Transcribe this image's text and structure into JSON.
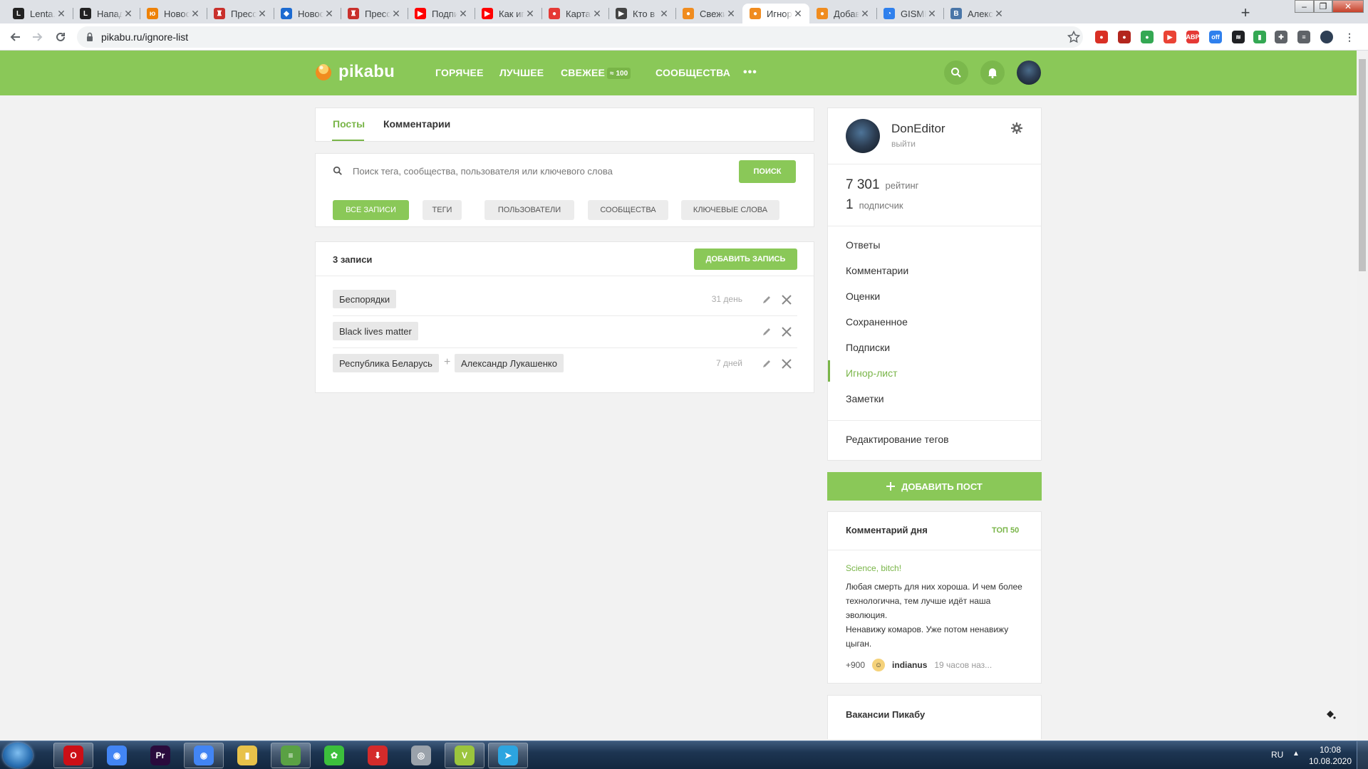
{
  "browser": {
    "tabs": [
      {
        "title": "Lenta.ru",
        "icon": "lenta-icon",
        "color": "#222222",
        "glyph": "L"
      },
      {
        "title": "Нападен",
        "icon": "lenta-icon",
        "color": "#222222",
        "glyph": "L"
      },
      {
        "title": "Новости",
        "icon": "ok-icon",
        "color": "#ee8208",
        "glyph": "ю"
      },
      {
        "title": "Пресс-це",
        "icon": "emblem-icon",
        "color": "#c9302c",
        "glyph": "♜"
      },
      {
        "title": "Новости",
        "icon": "flag-icon",
        "color": "#1c6bd1",
        "glyph": "◆"
      },
      {
        "title": "Пресс-це",
        "icon": "emblem-icon",
        "color": "#c9302c",
        "glyph": "♜"
      },
      {
        "title": "Подписк",
        "icon": "youtube-icon",
        "color": "#ff0000",
        "glyph": "▶"
      },
      {
        "title": "Как игра",
        "icon": "youtube-icon",
        "color": "#ff0000",
        "glyph": "▶"
      },
      {
        "title": "Карта ра",
        "icon": "maps-pin-icon",
        "color": "#e53935",
        "glyph": "●"
      },
      {
        "title": "Кто в",
        "icon": "play-icon",
        "color": "#444444",
        "glyph": "▶"
      },
      {
        "title": "Свежие",
        "icon": "pikabu-icon",
        "color": "#f08c1f",
        "glyph": "●"
      },
      {
        "title": "Игнор-л",
        "icon": "pikabu-icon",
        "color": "#f08c1f",
        "glyph": "●"
      },
      {
        "title": "Добавит",
        "icon": "pikabu-icon",
        "color": "#f08c1f",
        "glyph": "●"
      },
      {
        "title": "GISMETE",
        "icon": "gismeteo-icon",
        "color": "#2f80ed",
        "glyph": "◔"
      },
      {
        "title": "Алексан",
        "icon": "vk-icon",
        "color": "#4a76a8",
        "glyph": "В"
      }
    ],
    "active_tab_index": 11,
    "url": "pikabu.ru/ignore-list"
  },
  "site": {
    "logo_text": "pikabu",
    "nav": {
      "hot": "ГОРЯЧЕЕ",
      "best": "ЛУЧШЕЕ",
      "fresh": "СВЕЖЕЕ",
      "fresh_count": "100",
      "communities": "СООБЩЕСТВА",
      "more": "•••"
    }
  },
  "ignore": {
    "tabs": {
      "posts": "Посты",
      "comments": "Комментарии"
    },
    "search": {
      "placeholder": "Поиск тега, сообщества, пользователя или ключевого слова",
      "button": "ПОИСК"
    },
    "filters": [
      "ВСЕ ЗАПИСИ",
      "ТЕГИ",
      "ПОЛЬЗОВАТЕЛИ",
      "СООБЩЕСТВА",
      "КЛЮЧЕВЫЕ СЛОВА"
    ],
    "active_filter": "ВСЕ ЗАПИСИ",
    "count_label": "3 записи",
    "add_button": "ДОБАВИТЬ ЗАПИСЬ",
    "rows": [
      {
        "tags": [
          "Беспорядки"
        ],
        "age": "31 день"
      },
      {
        "tags": [
          "Black lives matter"
        ],
        "age": ""
      },
      {
        "tags": [
          "Республика Беларусь",
          "Александр Лукашенко"
        ],
        "age": "7 дней"
      }
    ]
  },
  "profile": {
    "name": "DonEditor",
    "logout": "выйти",
    "rating_value": "7 301",
    "rating_label": "рейтинг",
    "subscribers_value": "1",
    "subscribers_label": "подписчик",
    "menu": [
      "Ответы",
      "Комментарии",
      "Оценки",
      "Сохраненное",
      "Подписки",
      "Игнор-лист",
      "Заметки"
    ],
    "active_menu": "Игнор-лист",
    "edit_tags": "Редактирование тегов"
  },
  "add_post": "ДОБАВИТЬ ПОСТ",
  "comment_of_day": {
    "title": "Комментарий дня",
    "top_link": "ТОП 50",
    "post_title": "Science, bitch!",
    "text_line1": "Любая смерть для них хороша. И чем более технологична, тем лучше идёт наша эволюция.",
    "text_line2": "Ненавижу комаров. Уже потом ненавижу цыган.",
    "score": "+900",
    "user": "indianus",
    "time": "19 часов наз..."
  },
  "jobs_title": "Вакансии Пикабу",
  "taskbar": {
    "apps": [
      {
        "name": "opera",
        "color": "#cc0f16",
        "glyph": "O",
        "open": true
      },
      {
        "name": "chrome",
        "color": "#4285f4",
        "glyph": "◉",
        "open": false
      },
      {
        "name": "premiere",
        "color": "#2a0b3d",
        "glyph": "Pr",
        "open": false
      },
      {
        "name": "chrome-user",
        "color": "#4285f4",
        "glyph": "◉",
        "open": true
      },
      {
        "name": "explorer",
        "color": "#e8c24a",
        "glyph": "▮",
        "open": false
      },
      {
        "name": "notepad",
        "color": "#5aa144",
        "glyph": "≡",
        "open": true
      },
      {
        "name": "icq",
        "color": "#3cbf3c",
        "glyph": "✿",
        "open": false
      },
      {
        "name": "downloader",
        "color": "#d42b2b",
        "glyph": "⬇",
        "open": false
      },
      {
        "name": "disk",
        "color": "#9aa2ab",
        "glyph": "◎",
        "open": false
      },
      {
        "name": "vegas",
        "color": "#9bc53d",
        "glyph": "V",
        "open": true
      },
      {
        "name": "telegram",
        "color": "#2ca5e0",
        "glyph": "➤",
        "open": true
      }
    ],
    "language": "RU",
    "time": "10:08",
    "date": "10.08.2020"
  },
  "colors": {
    "accent": "#8ac858",
    "accent_text": "#79b548"
  }
}
